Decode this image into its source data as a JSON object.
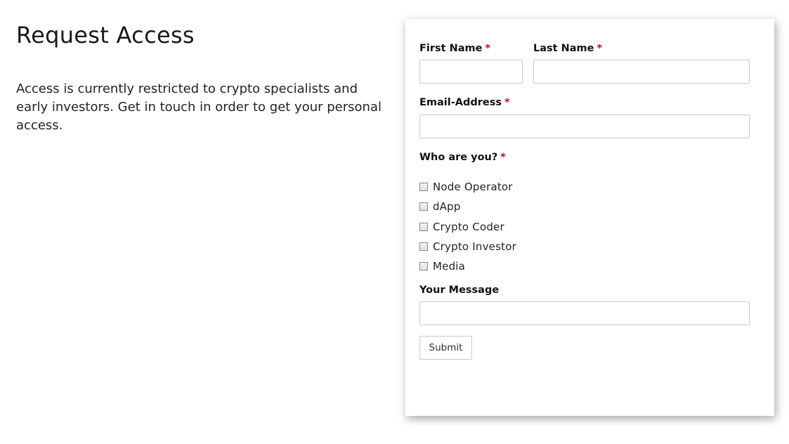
{
  "intro": {
    "title": "Request Access",
    "description": "Access is currently restricted to crypto specialists and early investors. Get in touch in order to get your personal access."
  },
  "form": {
    "first_name": {
      "label": "First Name",
      "required_marker": "*",
      "value": ""
    },
    "last_name": {
      "label": "Last Name",
      "required_marker": "*",
      "value": ""
    },
    "email": {
      "label": "Email-Address",
      "required_marker": "*",
      "value": ""
    },
    "who": {
      "label": "Who are you?",
      "required_marker": "*",
      "options": [
        {
          "label": "Node Operator",
          "checked": false
        },
        {
          "label": "dApp",
          "checked": false
        },
        {
          "label": "Crypto Coder",
          "checked": false
        },
        {
          "label": "Crypto Investor",
          "checked": false
        },
        {
          "label": "Media",
          "checked": false
        }
      ]
    },
    "message": {
      "label": "Your Message",
      "value": ""
    },
    "submit_label": "Submit"
  },
  "colors": {
    "required_marker": "#d0021b",
    "field_border": "#c8c8c8"
  }
}
